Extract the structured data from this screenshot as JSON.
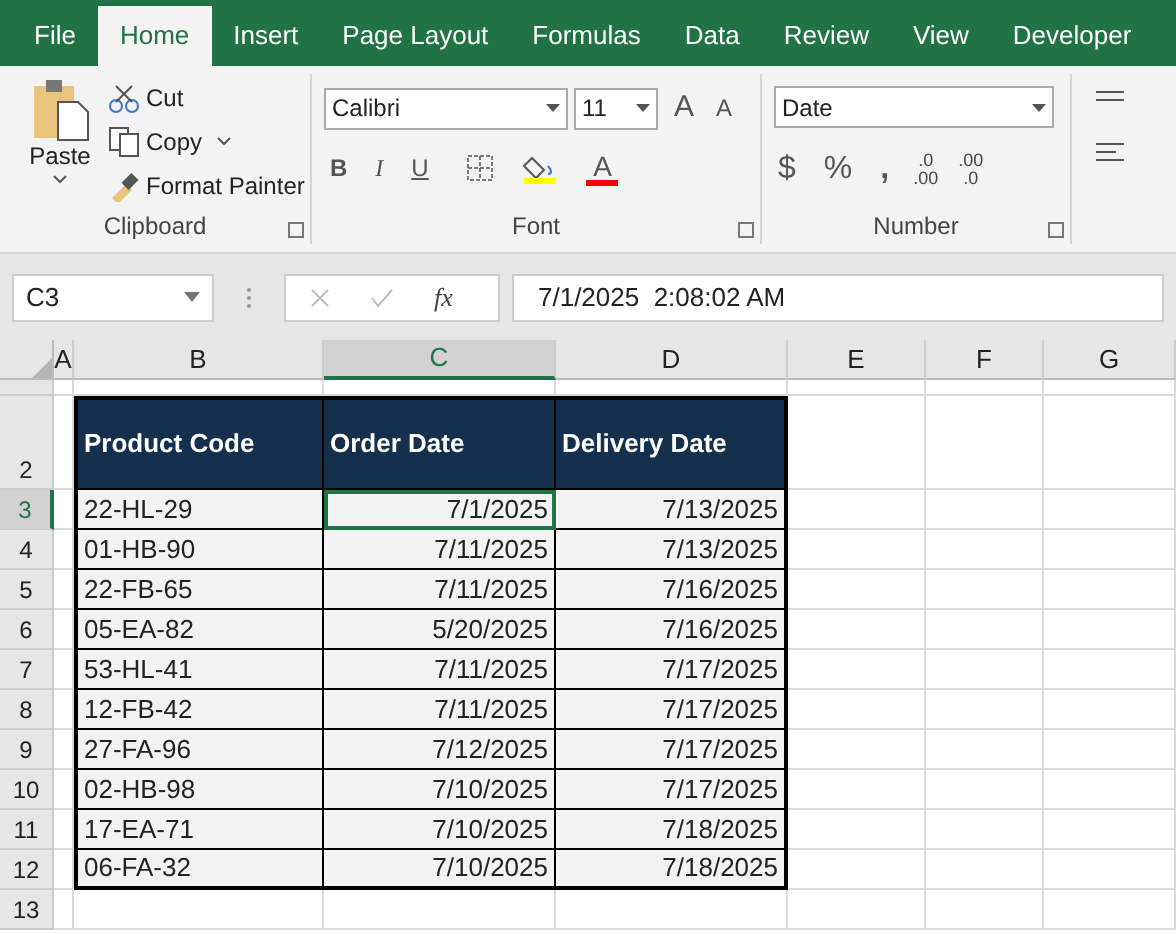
{
  "tabs": [
    {
      "label": "File",
      "selected": false
    },
    {
      "label": "Home",
      "selected": true
    },
    {
      "label": "Insert",
      "selected": false
    },
    {
      "label": "Page Layout",
      "selected": false
    },
    {
      "label": "Formulas",
      "selected": false
    },
    {
      "label": "Data",
      "selected": false
    },
    {
      "label": "Review",
      "selected": false
    },
    {
      "label": "View",
      "selected": false
    },
    {
      "label": "Developer",
      "selected": false
    }
  ],
  "clipboard": {
    "paste": "Paste",
    "cut": "Cut",
    "copy": "Copy",
    "format_painter": "Format Painter",
    "group_label": "Clipboard"
  },
  "font": {
    "family": "Calibri",
    "size": "11",
    "grow": "A",
    "shrink": "A",
    "bold": "B",
    "italic": "I",
    "underline": "U",
    "font_color": "A",
    "group_label": "Font"
  },
  "number": {
    "format": "Date",
    "currency": "$",
    "percent": "%",
    "comma": ",",
    "increase_decimal": [
      ".0",
      ".00"
    ],
    "decrease_decimal": [
      ".00",
      ".0"
    ],
    "group_label": "Number"
  },
  "formula_bar": {
    "name_box": "C3",
    "fx": "fx",
    "value": "7/1/2025  2:08:02 AM"
  },
  "columns": [
    {
      "label": "A",
      "selected": false
    },
    {
      "label": "B",
      "selected": false
    },
    {
      "label": "C",
      "selected": true
    },
    {
      "label": "D",
      "selected": false
    },
    {
      "label": "E",
      "selected": false
    },
    {
      "label": "F",
      "selected": false
    },
    {
      "label": "G",
      "selected": false
    }
  ],
  "row_numbers": [
    "2",
    "3",
    "4",
    "5",
    "6",
    "7",
    "8",
    "9",
    "10",
    "11",
    "12",
    "13"
  ],
  "table": {
    "columns": [
      "Product Code",
      "Order Date",
      "Delivery Date"
    ],
    "rows": [
      {
        "cells": [
          "22-HL-29",
          "7/1/2025",
          "7/13/2025"
        ],
        "selected": [
          false,
          true,
          false
        ]
      },
      {
        "cells": [
          "01-HB-90",
          "7/11/2025",
          "7/13/2025"
        ]
      },
      {
        "cells": [
          "22-FB-65",
          "7/11/2025",
          "7/16/2025"
        ]
      },
      {
        "cells": [
          "05-EA-82",
          "5/20/2025",
          "7/16/2025"
        ]
      },
      {
        "cells": [
          "53-HL-41",
          "7/11/2025",
          "7/17/2025"
        ]
      },
      {
        "cells": [
          "12-FB-42",
          "7/11/2025",
          "7/17/2025"
        ]
      },
      {
        "cells": [
          "27-FA-96",
          "7/12/2025",
          "7/17/2025"
        ]
      },
      {
        "cells": [
          "02-HB-98",
          "7/10/2025",
          "7/17/2025"
        ]
      },
      {
        "cells": [
          "17-EA-71",
          "7/10/2025",
          "7/18/2025"
        ]
      },
      {
        "cells": [
          "06-FA-32",
          "7/10/2025",
          "7/18/2025"
        ]
      }
    ]
  }
}
